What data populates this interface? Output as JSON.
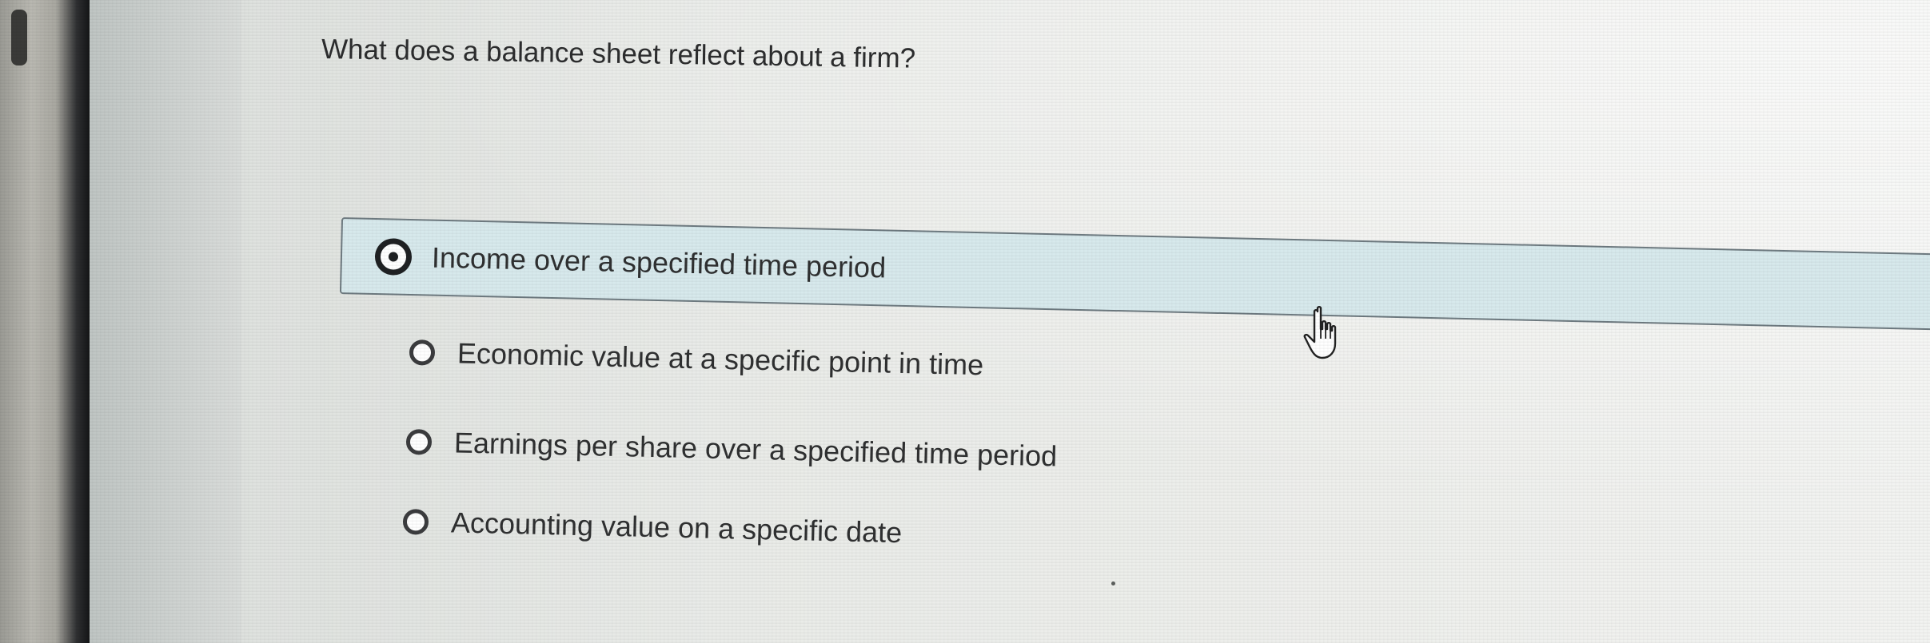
{
  "quiz": {
    "question": "What does a balance sheet reflect about a firm?",
    "options": [
      {
        "label": "Income over a specified time period",
        "selected": true
      },
      {
        "label": "Economic value at a specific point in time",
        "selected": false
      },
      {
        "label": "Earnings per share over a specified time period",
        "selected": false
      },
      {
        "label": "Accounting value on a specific date",
        "selected": false
      }
    ]
  },
  "cursor": {
    "icon": "hand-pointer-icon"
  },
  "colors": {
    "selected_background": "#d7e9ec",
    "selected_border": "#6e7a80",
    "text": "#2f3031"
  }
}
